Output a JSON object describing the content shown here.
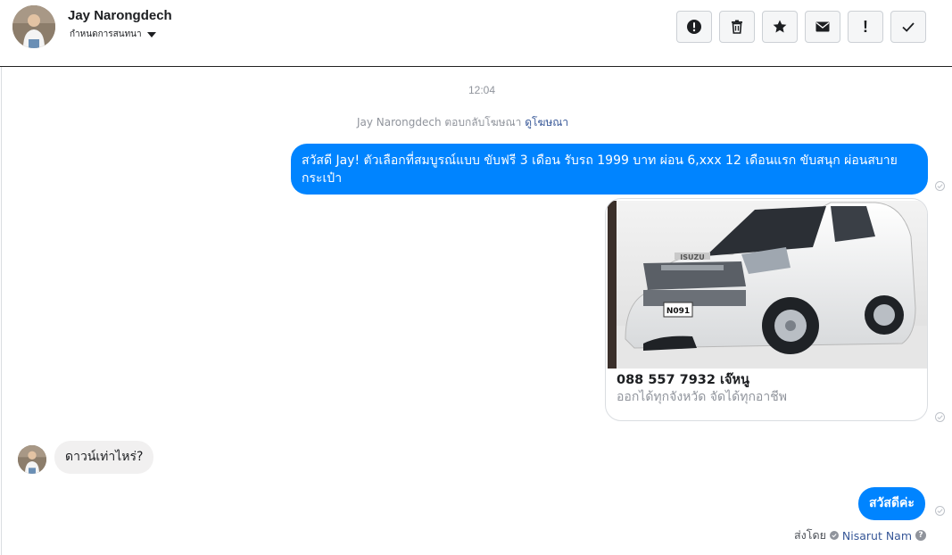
{
  "header": {
    "contact_name": "Jay Narongdech",
    "conversation_menu": "กำหนดการสนทนา",
    "toolbar": [
      {
        "icon": "alert-circle-icon",
        "text": ""
      },
      {
        "icon": "trash-icon",
        "text": ""
      },
      {
        "icon": "star-icon",
        "text": ""
      },
      {
        "icon": "envelope-icon",
        "text": ""
      },
      {
        "icon": "exclamation-icon",
        "text": "!"
      },
      {
        "icon": "check-icon",
        "text": ""
      }
    ]
  },
  "thread": {
    "timestamp": "12:04",
    "reply_note": {
      "text": "Jay Narongdech ตอบกลับโฆษณา",
      "link": "ดูโฆษณา"
    },
    "messages": [
      {
        "sender": "page",
        "text": "สวัสดี Jay! ตัวเลือกที่สมบูรณ์แบบ ขับฟรี 3 เดือน รับรถ 1999 บาท ผ่อน 6,xxx 12 เดือนแรก ขับสนุก ผ่อนสบายกระเป๋า"
      },
      {
        "sender": "page",
        "type": "ad_card",
        "image_icon": "white-pickup-truck-photo",
        "plate_text": "N091",
        "brand_text": "ISUZU",
        "title": "088 557 7932 เจ๊หนู",
        "subtitle": "ออกได้ทุกจังหวัด จัดได้ทุกอาชีพ"
      },
      {
        "sender": "customer",
        "text": "ดาวน์เท่าไหร่?"
      },
      {
        "sender": "page",
        "text": "สวัสดีค่ะ"
      }
    ],
    "sent_by": {
      "label": "ส่งโดย",
      "name": "Nisarut Nam",
      "help": "?"
    }
  },
  "colors": {
    "accent_blue": "#0084ff",
    "incoming_bubble": "#f1f0f0",
    "link": "#385898",
    "muted_text": "#90949c"
  }
}
